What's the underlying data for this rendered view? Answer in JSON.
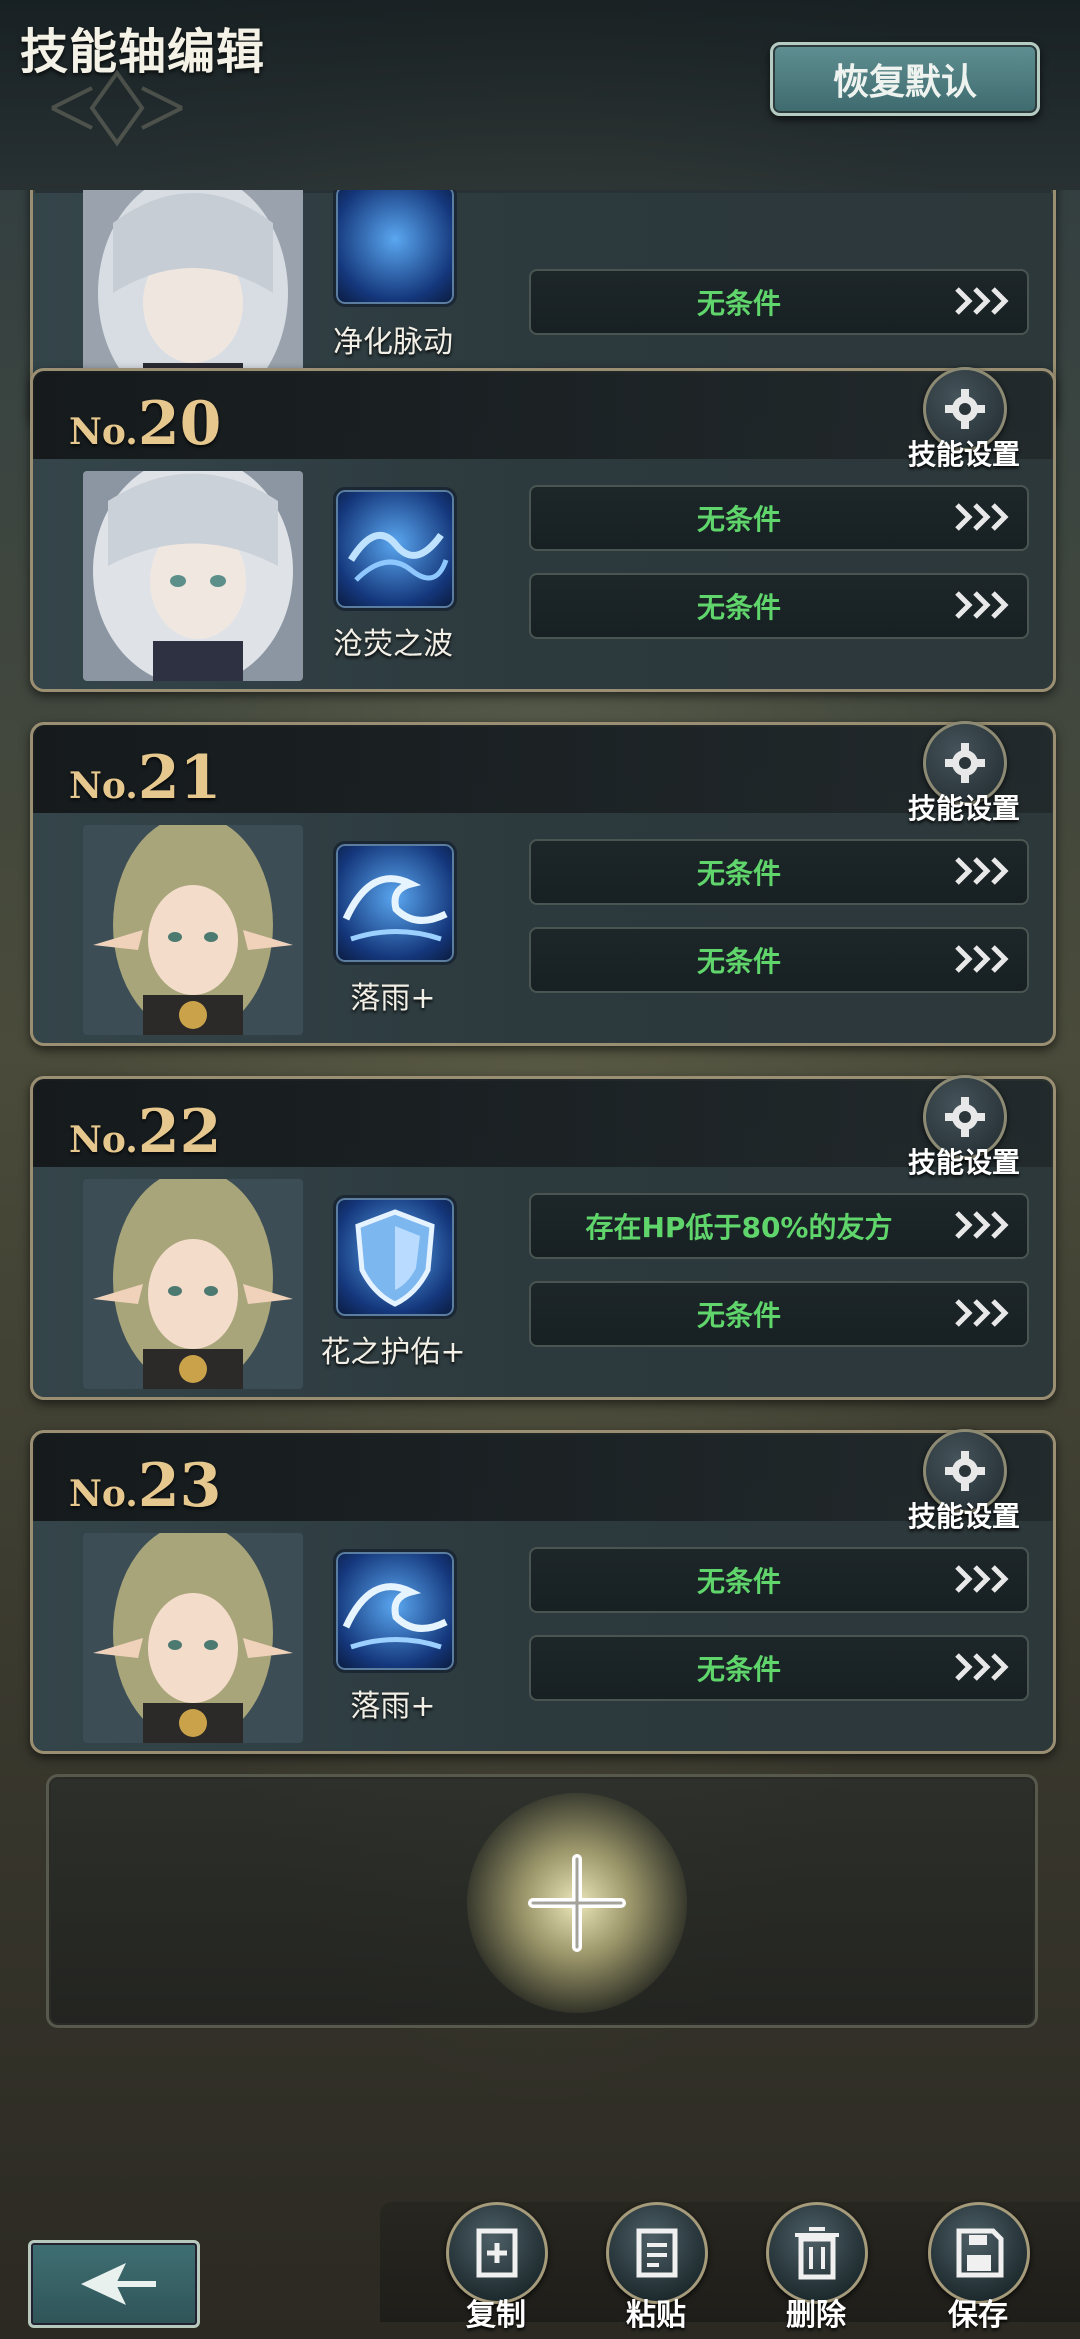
{
  "header": {
    "title": "技能轴编辑",
    "reset_label": "恢复默认"
  },
  "partial_card": {
    "skill_name": "净化脉动",
    "condition": "无条件"
  },
  "cards": [
    {
      "no_prefix": "No.",
      "number": "20",
      "settings_label": "技能设置",
      "skill_name": "沧荧之波",
      "conditions": [
        "无条件",
        "无条件"
      ],
      "portrait": "silver-haired-character-portrait",
      "skill_icon": "water-wave-skill-icon"
    },
    {
      "no_prefix": "No.",
      "number": "21",
      "settings_label": "技能设置",
      "skill_name": "落雨+",
      "conditions": [
        "无条件",
        "无条件"
      ],
      "portrait": "elf-character-portrait",
      "skill_icon": "rain-wave-skill-icon"
    },
    {
      "no_prefix": "No.",
      "number": "22",
      "settings_label": "技能设置",
      "skill_name": "花之护佑+",
      "conditions": [
        "存在HP低于80%的友方",
        "无条件"
      ],
      "portrait": "elf-character-portrait",
      "skill_icon": "shield-skill-icon"
    },
    {
      "no_prefix": "No.",
      "number": "23",
      "settings_label": "技能设置",
      "skill_name": "落雨+",
      "conditions": [
        "无条件",
        "无条件"
      ],
      "portrait": "elf-character-portrait",
      "skill_icon": "rain-wave-skill-icon"
    }
  ],
  "toolbar": {
    "copy_label": "复制",
    "paste_label": "粘贴",
    "delete_label": "删除",
    "save_label": "保存"
  },
  "colors": {
    "condition_text": "#5fd56b",
    "number_gold": "#e6c88f",
    "accent_teal": "#3e6a6e"
  }
}
